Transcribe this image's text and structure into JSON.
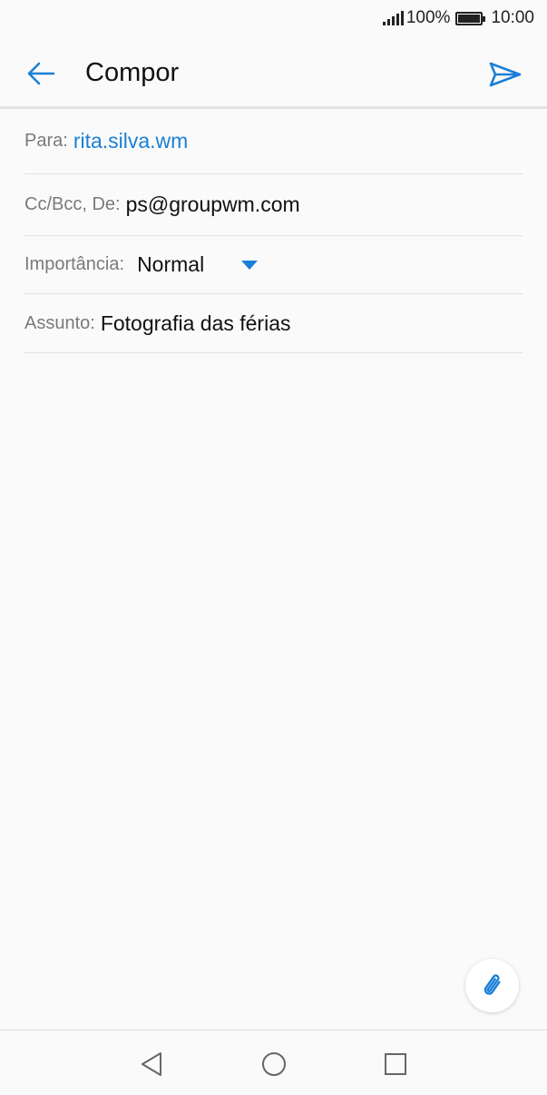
{
  "status_bar": {
    "battery_percent": "100%",
    "time": "10:00",
    "signal_icon": "signal-icon",
    "battery_icon": "battery-icon"
  },
  "app_bar": {
    "title": "Compor",
    "back_icon": "arrow-left-icon",
    "send_icon": "send-icon"
  },
  "form": {
    "to_label": "Para:",
    "to_value": "rita.silva.wm",
    "cc_label": "Cc/Bcc, De:",
    "cc_value": "ps@groupwm.com",
    "importance_label": "Importância:",
    "importance_value": "Normal",
    "subject_label": "Assunto:",
    "subject_value": "Fotografia das férias"
  },
  "attach_icon": "paperclip-icon",
  "nav_bar": {
    "back_icon": "nav-back-icon",
    "home_icon": "nav-home-icon",
    "recent_icon": "nav-recent-icon"
  },
  "colors": {
    "accent": "#1a7fd6",
    "label": "#7a7a7a",
    "background": "#fafafa"
  }
}
